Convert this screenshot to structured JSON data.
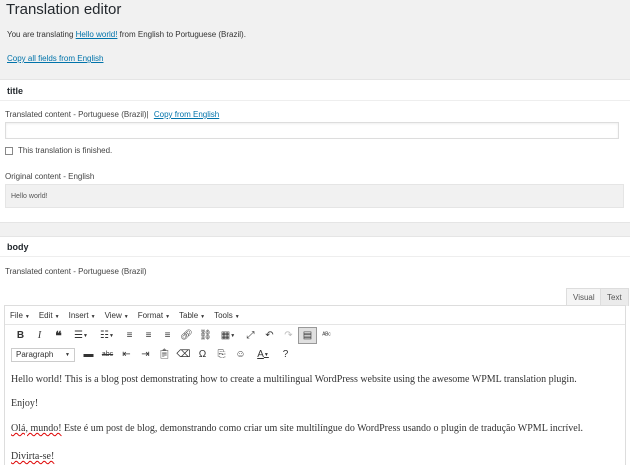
{
  "header": {
    "title": "Translation editor",
    "intro_prefix": "You are translating ",
    "intro_link": "Hello world!",
    "intro_suffix": " from English to Portuguese (Brazil).",
    "copy_all": "Copy all fields from English"
  },
  "title_panel": {
    "heading": "title",
    "translated_label": "Translated content - Portuguese (Brazil)|",
    "copy_from": "Copy from English",
    "input_value": "",
    "finished_label": "This translation is finished.",
    "original_label": "Original content - English",
    "original_value": "Hello world!"
  },
  "body_panel": {
    "heading": "body",
    "translated_label": "Translated content - Portuguese (Brazil)",
    "tab_visual": "Visual",
    "tab_text": "Text",
    "menu": [
      "File",
      "Edit",
      "Insert",
      "View",
      "Format",
      "Table",
      "Tools"
    ],
    "format_select": "Paragraph",
    "content": {
      "p1": "Hello world!  This is a blog post demonstrating how to create a multilingual WordPress website using the awesome WPML translation plugin.",
      "p2": "Enjoy!",
      "p3_a": "Olá, mundo!",
      "p3_b": "  Este é um post de blog, demonstrando como criar um site multilíngue do WordPress usando o plugin de tradução WPML incrível.",
      "p4": "Divirta-se!"
    }
  }
}
